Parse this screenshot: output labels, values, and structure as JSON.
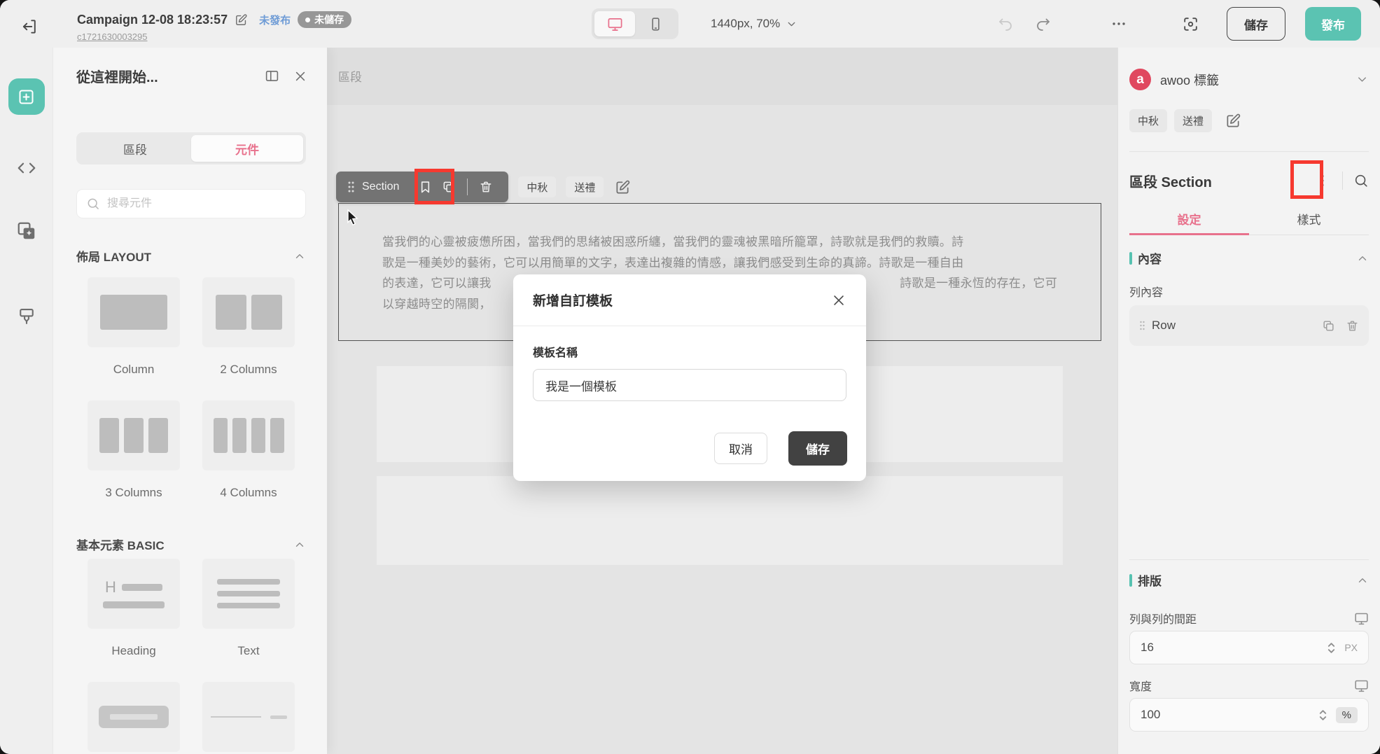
{
  "header": {
    "title": "Campaign 12-08 18:23:57",
    "status_unpublished": "未發布",
    "status_unsaved": "未儲存",
    "campaign_id": "c1721630003295",
    "viewport": "1440px, 70%",
    "save_label": "儲存",
    "publish_label": "發布"
  },
  "left_panel": {
    "title": "從這裡開始...",
    "tabs": {
      "sections": "區段",
      "elements": "元件"
    },
    "search_placeholder": "搜尋元件",
    "layout_heading": "佈局 LAYOUT",
    "basic_heading": "基本元素 BASIC",
    "items": {
      "column": "Column",
      "two_columns": "2 Columns",
      "three_columns": "3 Columns",
      "four_columns": "4 Columns",
      "heading": "Heading",
      "text": "Text"
    }
  },
  "canvas": {
    "section_zone_label": "區段",
    "toolbar": {
      "label": "Section",
      "tags": [
        "中秋",
        "送禮"
      ]
    },
    "text_lines": [
      {
        "left": "當我們的心靈被疲憊所困，當我們的思緒被困惑所纏，當我們的靈魂被黑暗所籠罩，詩歌就是我們的救贖。詩",
        "right": ""
      },
      {
        "left": "歌是一種美妙的藝術，它可以用簡單的文字，表達出複雜的情感，讓我們感受到生命的真諦。詩歌是一種自由",
        "right": ""
      },
      {
        "left": "的表達，它可以讓我",
        "right": "詩歌是一種永恆的存在，它可"
      },
      {
        "left": "以穿越時空的隔閡，",
        "right": ""
      }
    ]
  },
  "modal": {
    "title": "新增自訂模板",
    "field_label": "模板名稱",
    "field_value": "我是一個模板",
    "cancel_label": "取消",
    "save_label": "儲存"
  },
  "right_panel": {
    "awoo_label": "awoo 標籤",
    "awoo_logo_letter": "a",
    "tags": [
      "中秋",
      "送禮"
    ],
    "section_title": "區段 Section",
    "tabs": {
      "settings": "設定",
      "style": "樣式"
    },
    "content_heading": "內容",
    "row_content_label": "列內容",
    "row_item_label": "Row",
    "layout_heading": "排版",
    "row_gap_label": "列與列的間距",
    "row_gap_value": "16",
    "row_gap_unit": "PX",
    "width_label": "寬度",
    "width_value": "100",
    "width_unit": "%"
  },
  "colors": {
    "accent_teal": "#5bc3b2",
    "accent_pink": "#e8718c",
    "status_blue": "#6f9cd6",
    "logo_red": "#e0485f",
    "annotation_red": "#f6392f",
    "toolbar_gray": "#737373",
    "modal_save_dark": "#424242"
  }
}
